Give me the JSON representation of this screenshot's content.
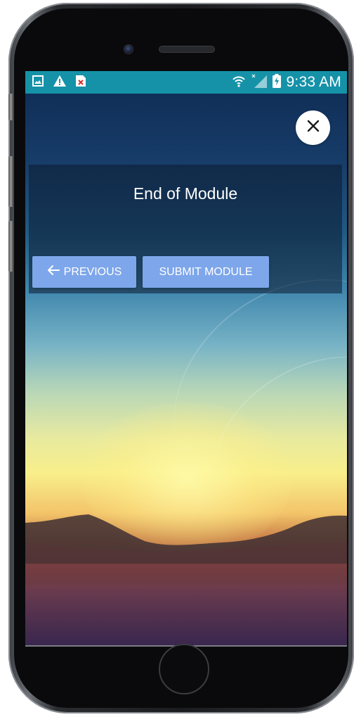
{
  "status_bar": {
    "time": "9:33 AM",
    "background_color": "#1592a8",
    "left_icons": [
      "image-icon",
      "warning-icon",
      "close-notification-icon"
    ],
    "right_icons": [
      "wifi-icon",
      "signal-icon",
      "battery-charging-icon"
    ]
  },
  "modal": {
    "title": "End of Module",
    "previous_label": "PREVIOUS",
    "submit_label": "SUBMIT MODULE",
    "button_color": "#7ea6ea"
  },
  "close_button": {
    "icon": "close-icon"
  }
}
